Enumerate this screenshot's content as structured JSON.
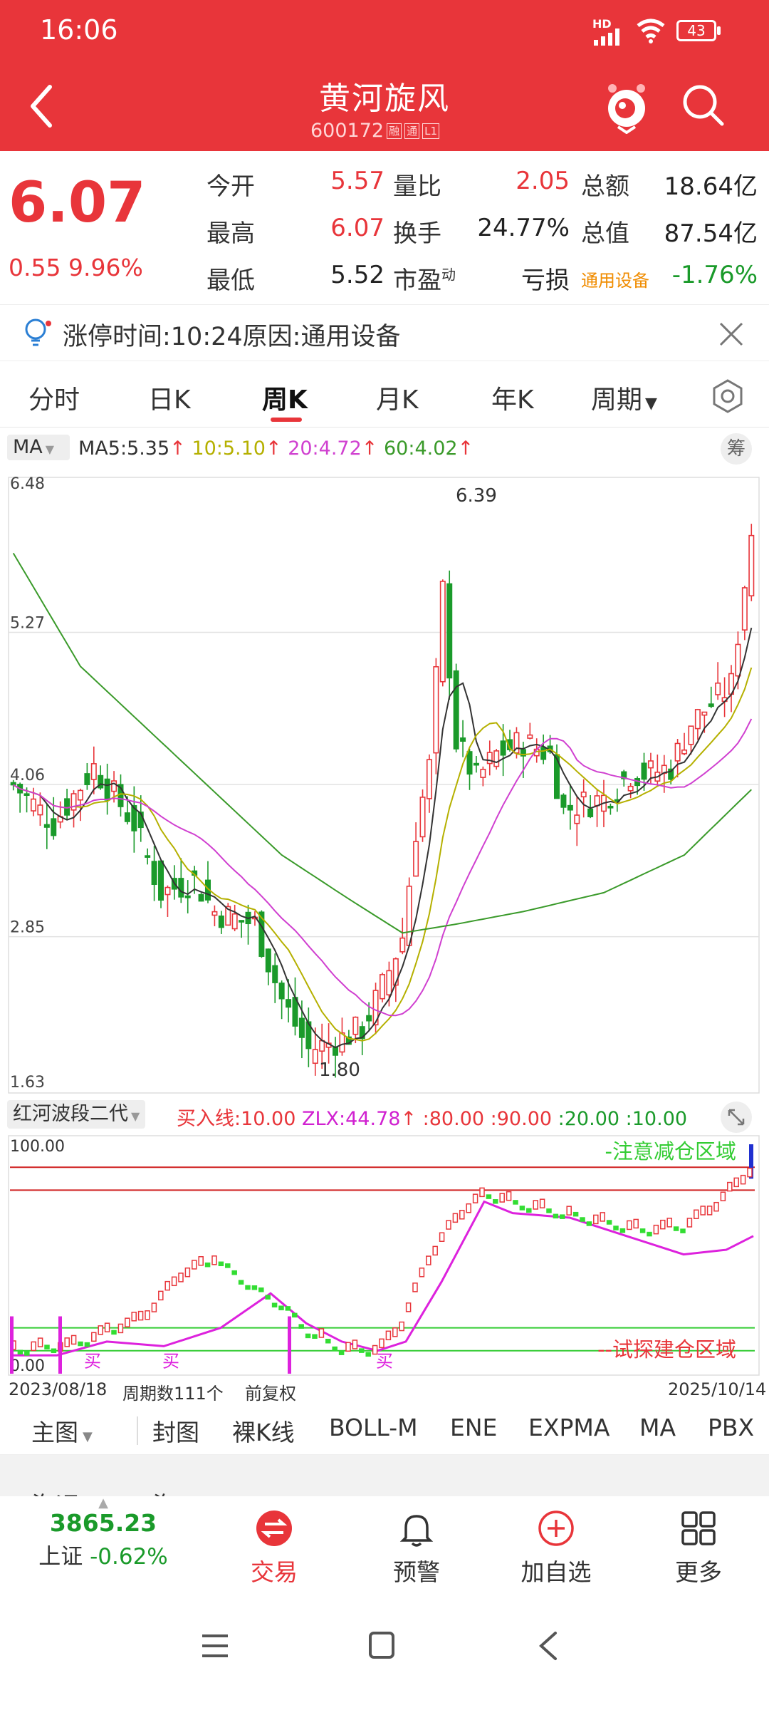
{
  "status_bar": {
    "time": "16:06",
    "hd_label": "HD",
    "battery": "43"
  },
  "header": {
    "title": "黄河旋风",
    "code": "600172",
    "badge_margin": "融",
    "badge_connect": "通",
    "badge_level": "L1"
  },
  "quote": {
    "price": "6.07",
    "change": "0.55",
    "change_pct": "9.96%",
    "rows": [
      [
        {
          "label": "今开",
          "value": "5.57",
          "color": "red"
        },
        {
          "label": "量比",
          "value": "2.05",
          "color": "red"
        },
        {
          "label": "总额",
          "value": "18.64亿",
          "color": "black"
        }
      ],
      [
        {
          "label": "最高",
          "value": "6.07",
          "color": "red"
        },
        {
          "label": "换手",
          "value": "24.77%",
          "color": "black"
        },
        {
          "label": "总值",
          "value": "87.54亿",
          "color": "black"
        }
      ],
      [
        {
          "label": "最低",
          "value": "5.52",
          "color": "black"
        },
        {
          "label": "市盈",
          "sup": "动",
          "value": "亏损",
          "color": "black"
        },
        {
          "label": "通用设备",
          "value": "-1.76%",
          "color": "green"
        }
      ]
    ]
  },
  "notice": {
    "text": "涨停时间:10:24原因:通用设备"
  },
  "tabs": [
    "分时",
    "日K",
    "周K",
    "月K",
    "年K",
    "周期"
  ],
  "active_tab": "周K",
  "ma_bar": {
    "selector": "MA",
    "ma5": "MA5:5.35",
    "ma10": "10:5.10",
    "ma20": "20:4.72",
    "ma60": "60:4.02",
    "chip_btn": "筹",
    "arrow": "↑"
  },
  "main_chart": {
    "y_labels": [
      "6.48",
      "5.27",
      "4.06",
      "2.85",
      "1.63"
    ],
    "max_label": "6.39",
    "min_label": "1.80"
  },
  "indicator": {
    "name": "红河波段二代",
    "buy_line": "买入线:10.00",
    "zlx": "ZLX:44.78",
    "arrow": "↑",
    "v80": ":80.00",
    "v90": ":90.00",
    "v20": ":20.00",
    "v10": ":10.00",
    "top_label": "100.00",
    "bottom_label": "0.00",
    "reduce_zone": "-注意减仓区域",
    "build_zone": "--试探建仓区域",
    "buy_marker": "买"
  },
  "chart_footer": {
    "start_date": "2023/08/18",
    "period_count": "周期数111个",
    "adjust": "前复权",
    "end_date": "2025/10/14"
  },
  "bottom_tabs": [
    "主图",
    "封图",
    "裸K线",
    "BOLL-M",
    "ENE",
    "EXPMA",
    "MA",
    "PBX"
  ],
  "bottom_active": "MA",
  "peek_row": [
    "海运",
    "海..."
  ],
  "nav": {
    "index_value": "3865.23",
    "index_name": "上证",
    "index_change": "-0.62%",
    "trade": "交易",
    "alert": "预警",
    "add": "加自选",
    "more": "更多"
  },
  "colors": {
    "brand_red": "#e8353a",
    "up_red": "#e8353a",
    "down_green": "#1a9a2a",
    "ma5": "#333333",
    "ma10": "#b5b000",
    "ma20": "#d040d0",
    "ma60": "#3a9a2a"
  }
}
